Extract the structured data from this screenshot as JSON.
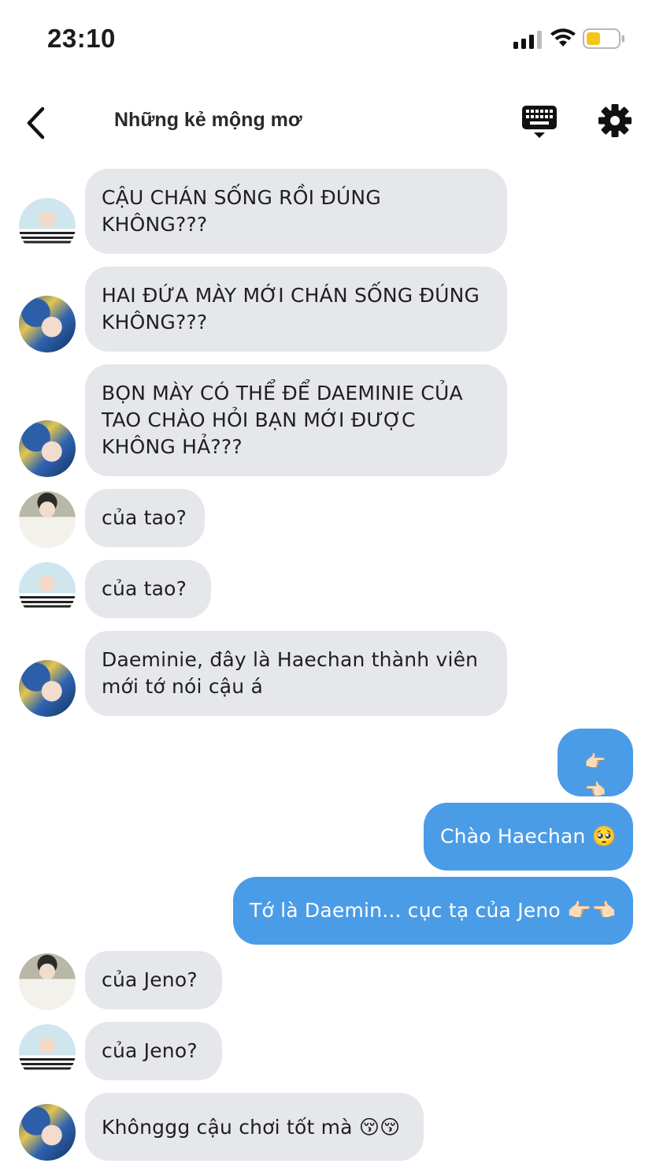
{
  "status": {
    "time": "23:10",
    "battery_color": "#f5c518"
  },
  "header": {
    "title": "Những kẻ mộng mơ"
  },
  "icons": {
    "back": "chevron-left-icon",
    "keyboard": "keyboard-icon",
    "settings": "gear-icon"
  },
  "messages": [
    {
      "side": "in",
      "avatar": "a",
      "text": "CẬU CHÁN SỐNG RỒI ĐÚNG KHÔNG???"
    },
    {
      "side": "in",
      "avatar": "b",
      "text": "HAI ĐỨA MÀY MỚI CHÁN SỐNG ĐÚNG KHÔNG???"
    },
    {
      "side": "in",
      "avatar": "b",
      "text": "BỌN MÀY CÓ THỂ ĐỂ DAEMINIE CỦA TAO CHÀO HỎI BẠN MỚI ĐƯỢC KHÔNG HẢ???"
    },
    {
      "side": "in",
      "avatar": "c",
      "text": "của tao?"
    },
    {
      "side": "in",
      "avatar": "a",
      "text": "của tao?"
    },
    {
      "side": "in",
      "avatar": "b",
      "text": "Daeminie, đây là Haechan thành viên mới tớ nói cậu á"
    },
    {
      "side": "out",
      "text": "👉🏻👈🏻"
    },
    {
      "side": "out",
      "text": "Chào Haechan 🥺"
    },
    {
      "side": "out",
      "text": "Tớ là Daemin... cục tạ của Jeno 👉🏻👈🏻"
    },
    {
      "side": "in",
      "avatar": "c",
      "text": "của Jeno?"
    },
    {
      "side": "in",
      "avatar": "a",
      "text": "của Jeno?"
    },
    {
      "side": "in",
      "avatar": "b",
      "text": "Khônggg cậu chơi tốt mà 😚😚"
    }
  ]
}
